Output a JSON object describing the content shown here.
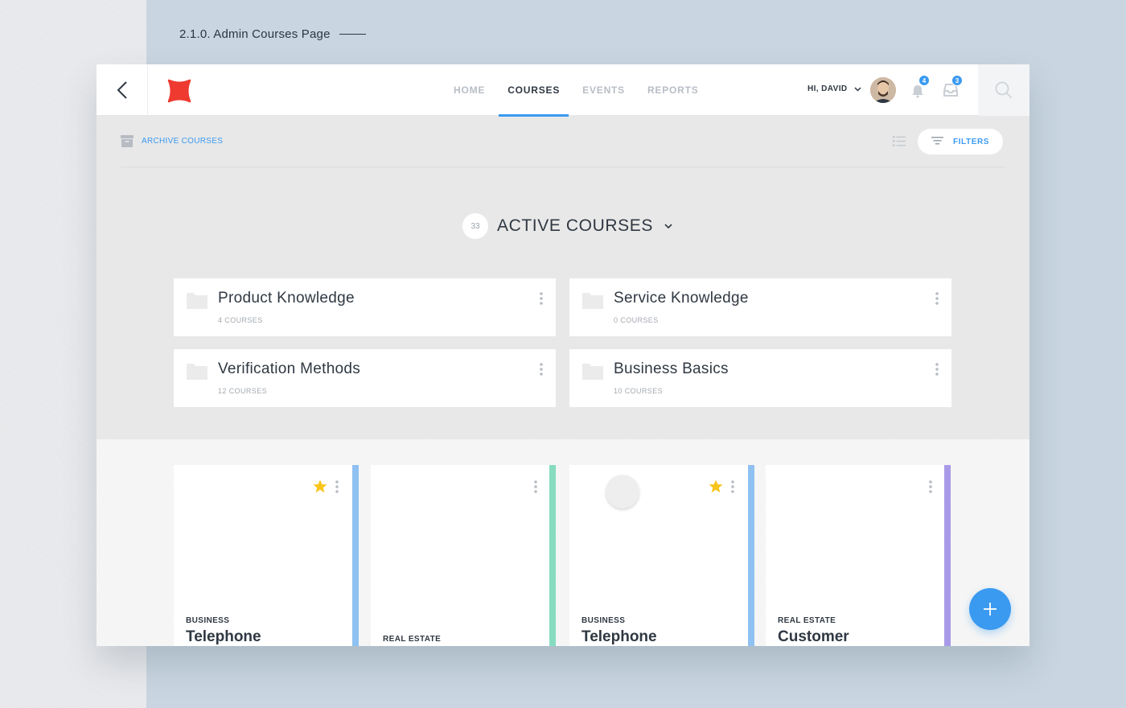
{
  "caption": "2.1.0. Admin Courses Page",
  "nav": {
    "items": [
      {
        "label": "HOME"
      },
      {
        "label": "COURSES"
      },
      {
        "label": "EVENTS"
      },
      {
        "label": "REPORTS"
      }
    ],
    "active": "COURSES"
  },
  "user": {
    "greeting": "HI, DAVID",
    "notifications_count": "4",
    "inbox_count": "3"
  },
  "toolbar": {
    "archive_label": "ARCHIVE COURSES",
    "filters_label": "FILTERS"
  },
  "active_courses": {
    "count": "33",
    "title": "ACTIVE COURSES"
  },
  "folders": [
    {
      "title": "Product Knowledge",
      "sub": "4 COURSES"
    },
    {
      "title": "Service Knowledge",
      "sub": "0 COURSES"
    },
    {
      "title": "Verification Methods",
      "sub": "12 COURSES"
    },
    {
      "title": "Business Basics",
      "sub": "10 COURSES"
    }
  ],
  "cards": [
    {
      "category": "BUSINESS",
      "title": "Telephone",
      "starred": true,
      "stripe": "#8fc1f2"
    },
    {
      "category": "REAL ESTATE",
      "title": "",
      "starred": false,
      "stripe": "#86dcc0"
    },
    {
      "category": "BUSINESS",
      "title": "Telephone",
      "starred": true,
      "stripe": "#8fc1f2"
    },
    {
      "category": "REAL ESTATE",
      "title": "Customer",
      "starred": false,
      "stripe": "#a99ae8"
    }
  ],
  "colors": {
    "accent": "#3a9af0",
    "logo": "#ee3a2f",
    "star": "#f7c51c"
  }
}
